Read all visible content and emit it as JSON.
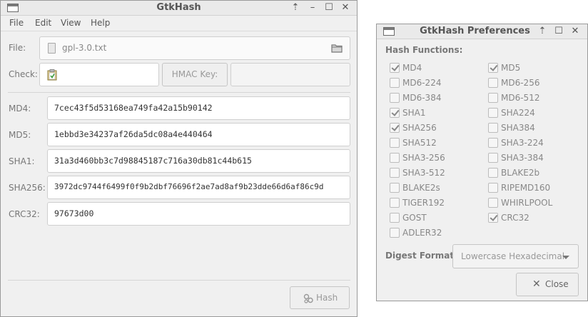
{
  "main": {
    "title": "GtkHash",
    "menu": [
      "File",
      "Edit",
      "View",
      "Help"
    ],
    "file_label": "File:",
    "file_name": "gpl-3.0.txt",
    "check_label": "Check:",
    "check_value": "",
    "hmac_label": "HMAC Key:",
    "hmac_value": "",
    "hashes": [
      {
        "label": "MD4:",
        "value": "7cec43f5d53168ea749fa42a15b90142"
      },
      {
        "label": "MD5:",
        "value": "1ebbd3e34237af26da5dc08a4e440464"
      },
      {
        "label": "SHA1:",
        "value": "31a3d460bb3c7d98845187c716a30db81c44b615"
      },
      {
        "label": "SHA256:",
        "value": "3972dc9744f6499f0f9b2dbf76696f2ae7ad8af9b23dde66d6af86c9d"
      },
      {
        "label": "CRC32:",
        "value": "97673d00"
      }
    ],
    "hash_button": "Hash"
  },
  "prefs": {
    "title": "GtkHash Preferences",
    "section_label": "Hash Functions:",
    "functions": [
      {
        "name": "MD4",
        "checked": true
      },
      {
        "name": "MD5",
        "checked": true
      },
      {
        "name": "MD6-224",
        "checked": false
      },
      {
        "name": "MD6-256",
        "checked": false
      },
      {
        "name": "MD6-384",
        "checked": false
      },
      {
        "name": "MD6-512",
        "checked": false
      },
      {
        "name": "SHA1",
        "checked": true
      },
      {
        "name": "SHA224",
        "checked": false
      },
      {
        "name": "SHA256",
        "checked": true
      },
      {
        "name": "SHA384",
        "checked": false
      },
      {
        "name": "SHA512",
        "checked": false
      },
      {
        "name": "SHA3-224",
        "checked": false
      },
      {
        "name": "SHA3-256",
        "checked": false
      },
      {
        "name": "SHA3-384",
        "checked": false
      },
      {
        "name": "SHA3-512",
        "checked": false
      },
      {
        "name": "BLAKE2b",
        "checked": false
      },
      {
        "name": "BLAKE2s",
        "checked": false
      },
      {
        "name": "RIPEMD160",
        "checked": false
      },
      {
        "name": "TIGER192",
        "checked": false
      },
      {
        "name": "WHIRLPOOL",
        "checked": false
      },
      {
        "name": "GOST",
        "checked": false
      },
      {
        "name": "CRC32",
        "checked": true
      },
      {
        "name": "ADLER32",
        "checked": false
      }
    ],
    "digest_label": "Digest Format:",
    "digest_value": "Lowercase Hexadecimal",
    "close_button": "Close"
  }
}
